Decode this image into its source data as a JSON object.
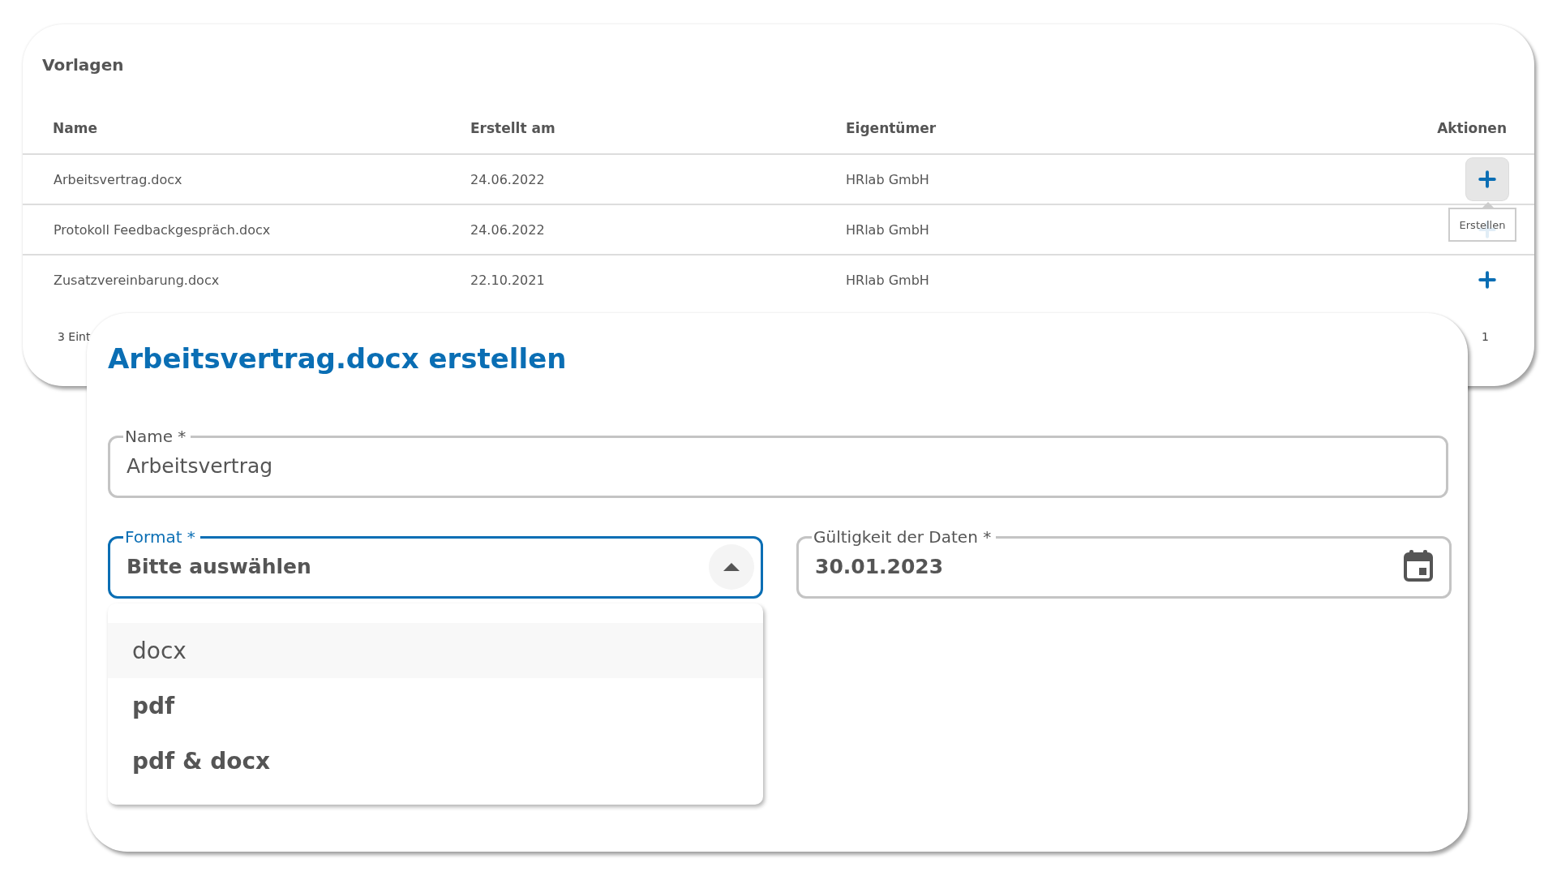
{
  "templates": {
    "title": "Vorlagen",
    "columns": [
      "Name",
      "Erstellt am",
      "Eigentümer",
      "Aktionen"
    ],
    "rows": [
      {
        "name": "Arbeitsvertrag.docx",
        "created": "24.06.2022",
        "owner": "HRlab GmbH",
        "hovered": true,
        "tooltip": "Erstellen"
      },
      {
        "name": "Protokoll Feedbackgespräch.docx",
        "created": "24.06.2022",
        "owner": "HRlab GmbH",
        "hovered": false
      },
      {
        "name": "Zusatzvereinbarung.docx",
        "created": "22.10.2021",
        "owner": "HRlab GmbH",
        "hovered": false
      }
    ],
    "footer_count": "3 Eint",
    "page": "1"
  },
  "dialog": {
    "title": "Arbeitsvertrag.docx erstellen",
    "name_field": {
      "label": "Name *",
      "value": "Arbeitsvertrag"
    },
    "format_field": {
      "label": "Format *",
      "value": "Bitte auswählen",
      "focused": true,
      "expanded": true,
      "options": [
        {
          "label": "docx",
          "selected": true
        },
        {
          "label": "pdf",
          "selected": false
        },
        {
          "label": "pdf & docx",
          "selected": false
        }
      ]
    },
    "date_field": {
      "label": "Gültigkeit der Daten *",
      "value": "30.01.2023",
      "focused": false
    }
  }
}
